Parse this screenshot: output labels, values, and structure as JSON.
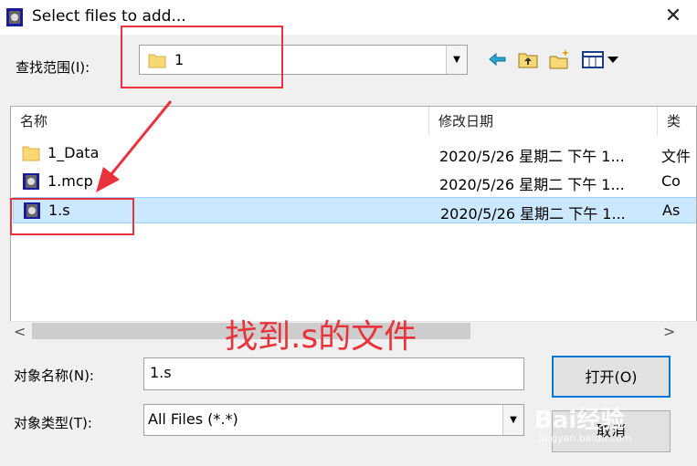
{
  "window": {
    "title": "Select files to add...",
    "close_glyph": "✕"
  },
  "lookin": {
    "label": "查找范围(I):",
    "value": "1",
    "dropdown_glyph": "▼"
  },
  "toolbar": {
    "icons": [
      "back-arrow-icon",
      "up-folder-icon",
      "new-folder-icon",
      "view-menu-icon"
    ]
  },
  "list": {
    "columns": [
      "名称",
      "修改日期",
      "类"
    ],
    "sort_glyph": "^",
    "rows": [
      {
        "name": "1_Data",
        "date": "2020/5/26 星期二 下午 1...",
        "type": "文件",
        "icon": "folder-icon"
      },
      {
        "name": "1.mcp",
        "date": "2020/5/26 星期二 下午 1...",
        "type": "Co",
        "icon": "mcp-file-icon"
      },
      {
        "name": "1.s",
        "date": "2020/5/26 星期二 下午 1...",
        "type": "As",
        "icon": "s-file-icon",
        "selected": true
      }
    ],
    "scroll_left": "<",
    "scroll_right": ">"
  },
  "annotation": {
    "text": "找到.s的文件",
    "color": "#e8323c"
  },
  "filename": {
    "label": "对象名称(N):",
    "value": "1.s"
  },
  "filetype": {
    "label": "对象类型(T):",
    "value": "All Files (*.*)",
    "dropdown_glyph": "▼"
  },
  "buttons": {
    "open": "打开(O)",
    "cancel": "取消"
  },
  "watermark": {
    "text": "Bai经验",
    "sub": "jingyan.baidu.com"
  },
  "colors": {
    "selection": "#cce8ff",
    "folder": "#f8d775",
    "annotation": "#e8323c",
    "focus": "#0078d7"
  }
}
